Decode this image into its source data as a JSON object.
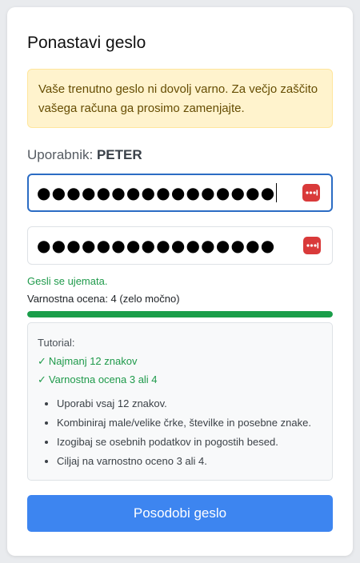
{
  "title": "Ponastavi geslo",
  "alert": {
    "text": "Vaše trenutno geslo ni dovolj varno. Za večjo zaščito vašega računa ga prosimo zamenjajte.",
    "color": "#fff3cd"
  },
  "user": {
    "label": "Uporabnik:",
    "name": "PETER"
  },
  "password_field": {
    "masked_value": "●●●●●●●●●●●●●●●●",
    "icon": "password-manager-icon"
  },
  "confirm_field": {
    "masked_value": "●●●●●●●●●●●●●●●●",
    "icon": "password-manager-icon"
  },
  "match_text": "Gesli se ujemata.",
  "strength": {
    "label": "Varnostna ocena: 4 (zelo močno)",
    "fraction": 1.0,
    "color": "#1a9e4a"
  },
  "tutorial": {
    "heading": "Tutorial:",
    "checks": [
      {
        "mark": "✓",
        "text": "Najmanj 12 znakov"
      },
      {
        "mark": "✓",
        "text": "Varnostna ocena 3 ali 4"
      }
    ],
    "tips": [
      "Uporabi vsaj 12 znakov.",
      "Kombiniraj male/velike črke, številke in posebne znake.",
      "Izogibaj se osebnih podatkov in pogostih besed.",
      "Ciljaj na varnostno oceno 3 ali 4."
    ]
  },
  "submit_label": "Posodobi geslo",
  "accent_color": "#3d85f0"
}
